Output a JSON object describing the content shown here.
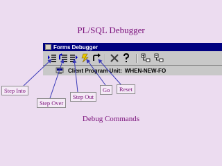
{
  "slide": {
    "title": "PL/SQL Debugger",
    "caption": "Debug Commands"
  },
  "window": {
    "title": "Forms Debugger",
    "client_label": "Client Program Unit:",
    "client_value": "WHEN-NEW-FO"
  },
  "toolbar": {
    "buttons": [
      {
        "name": "step-into-button",
        "icon": "step-into-icon"
      },
      {
        "name": "step-over-button",
        "icon": "step-over-icon"
      },
      {
        "name": "step-out-button",
        "icon": "step-out-icon"
      },
      {
        "name": "go-button",
        "icon": "go-icon"
      },
      {
        "name": "reset-button",
        "icon": "reset-icon"
      },
      {
        "name": "stop-button",
        "icon": "stop-icon"
      },
      {
        "name": "help-button",
        "icon": "help-icon"
      },
      {
        "name": "expand-button",
        "icon": "expand-icon"
      },
      {
        "name": "collapse-button",
        "icon": "collapse-icon"
      }
    ]
  },
  "labels": {
    "step_into": "Step Into",
    "step_over": "Step Over",
    "step_out": "Step Out",
    "go": "Go",
    "reset": "Reset"
  },
  "colors": {
    "background": "#ecdcf0",
    "text": "#7a0f7a",
    "arrow": "#3a3ab8",
    "titlebar": "#000080"
  }
}
